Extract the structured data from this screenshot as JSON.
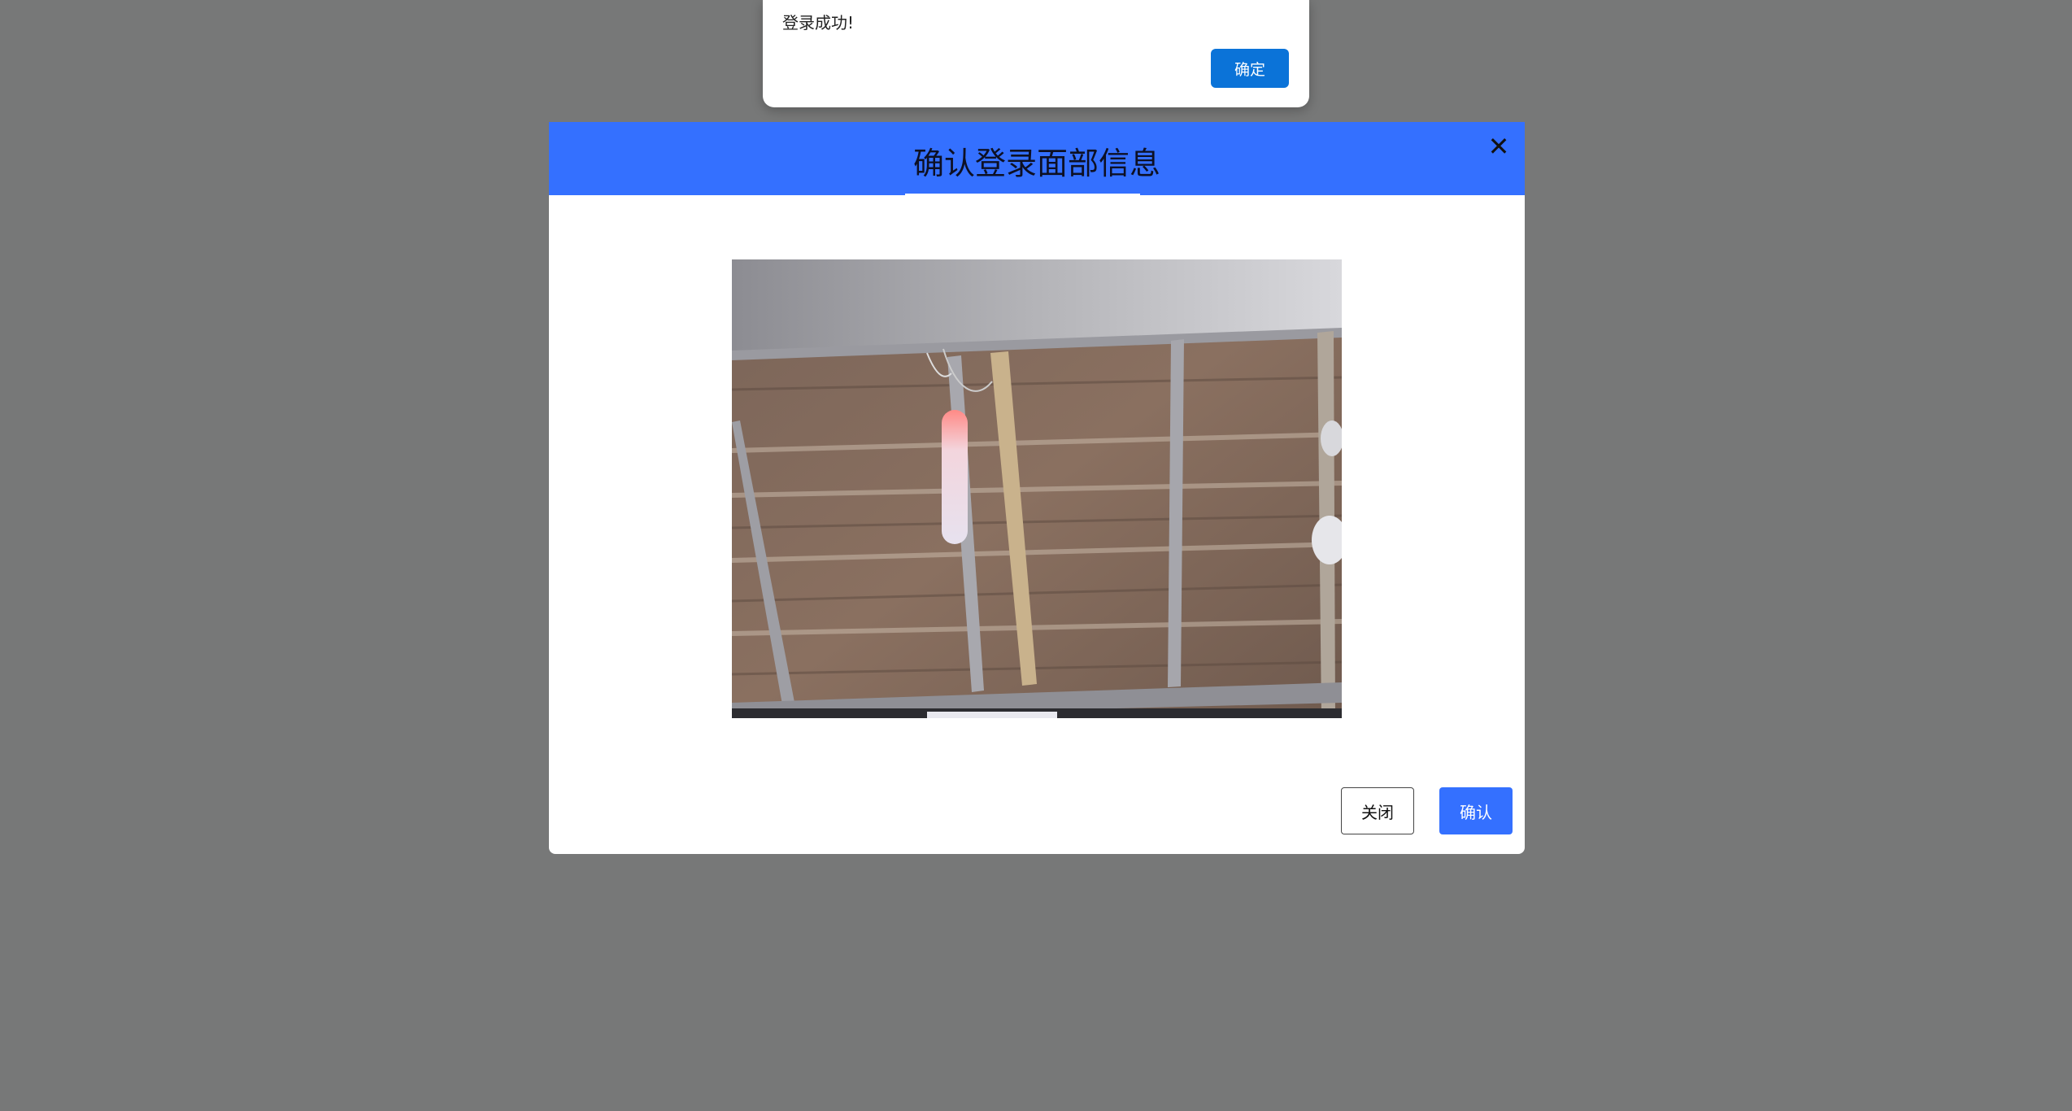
{
  "alert": {
    "message": "登录成功!",
    "ok_label": "确定",
    "ok_color": "#0b73d8"
  },
  "modal": {
    "title": "确认登录面部信息",
    "close_icon": "close-icon",
    "header_color": "#3470ff",
    "image_description": "camera-capture",
    "buttons": {
      "close_label": "关闭",
      "confirm_label": "确认"
    }
  }
}
